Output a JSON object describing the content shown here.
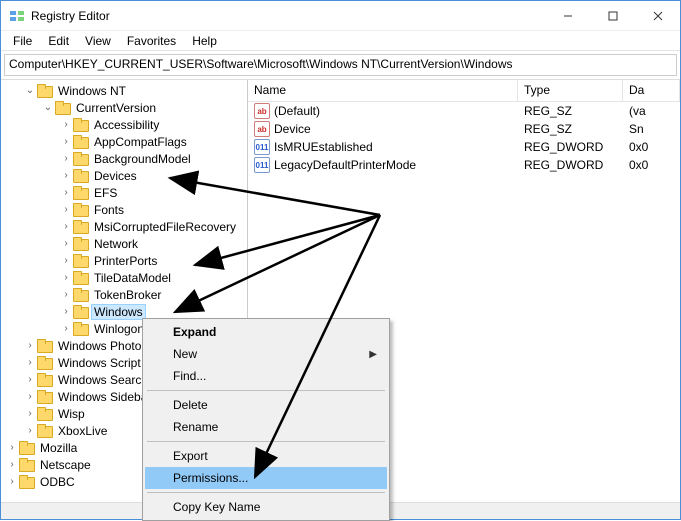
{
  "window": {
    "title": "Registry Editor"
  },
  "menus": [
    "File",
    "Edit",
    "View",
    "Favorites",
    "Help"
  ],
  "address": "Computer\\HKEY_CURRENT_USER\\Software\\Microsoft\\Windows NT\\CurrentVersion\\Windows",
  "tree": {
    "root": "Windows NT",
    "cv": "CurrentVersion",
    "children": [
      "Accessibility",
      "AppCompatFlags",
      "BackgroundModel",
      "Devices",
      "EFS",
      "Fonts",
      "MsiCorruptedFileRecovery",
      "Network",
      "PrinterPorts",
      "TileDataModel",
      "TokenBroker",
      "Windows",
      "Winlogon"
    ],
    "siblings": [
      "Windows Photo",
      "Windows Script",
      "Windows Search",
      "Windows Sideba",
      "Wisp",
      "XboxLive"
    ],
    "roots2": [
      "Mozilla",
      "Netscape",
      "ODBC"
    ]
  },
  "columns": {
    "name": "Name",
    "type": "Type",
    "data": "Da"
  },
  "values": [
    {
      "icon": "str",
      "name": "(Default)",
      "type": "REG_SZ",
      "data": "(va"
    },
    {
      "icon": "str",
      "name": "Device",
      "type": "REG_SZ",
      "data": "Sn"
    },
    {
      "icon": "bin",
      "name": "IsMRUEstablished",
      "type": "REG_DWORD",
      "data": "0x0"
    },
    {
      "icon": "bin",
      "name": "LegacyDefaultPrinterMode",
      "type": "REG_DWORD",
      "data": "0x0"
    }
  ],
  "ctx": {
    "expand": "Expand",
    "new": "New",
    "find": "Find...",
    "delete": "Delete",
    "rename": "Rename",
    "export": "Export",
    "permissions": "Permissions...",
    "copy": "Copy Key Name"
  }
}
